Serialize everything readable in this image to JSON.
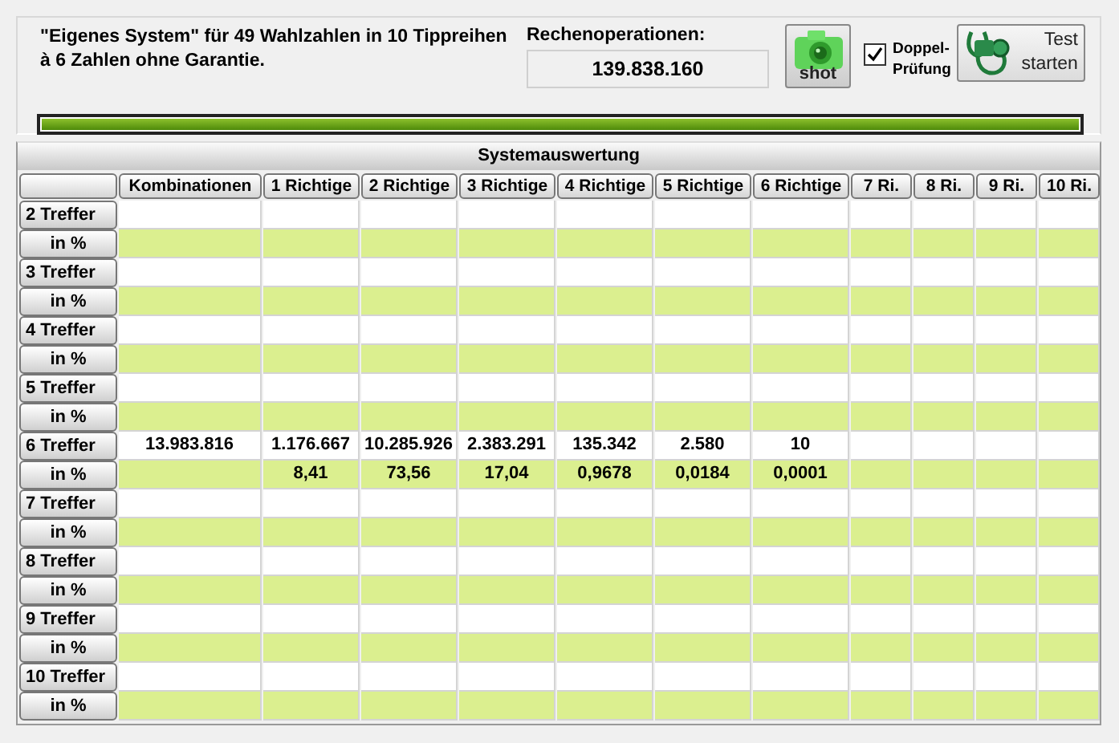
{
  "description_lines": [
    "\"Eigenes System\" für 49 Wahlzahlen in 10 Tippreihen",
    "à 6 Zahlen ohne Garantie."
  ],
  "operations": {
    "label": "Rechenoperationen:",
    "value": "139.838.160"
  },
  "shot_button": {
    "label": "shot"
  },
  "double_check": {
    "label_lines": [
      "Doppel-",
      "Prüfung"
    ],
    "checked": true
  },
  "test_button": {
    "label_lines": [
      "Test",
      "starten"
    ]
  },
  "progress": {
    "level": 1
  },
  "table": {
    "title": "Systemauswertung",
    "columns": [
      "Kombinationen",
      "1 Richtige",
      "2 Richtige",
      "3 Richtige",
      "4 Richtige",
      "5 Richtige",
      "6 Richtige",
      "7 Ri.",
      "8 Ri.",
      "9 Ri.",
      "10 Ri."
    ],
    "rows": [
      {
        "label": "2 Treffer",
        "kind": "count"
      },
      {
        "label": "in %",
        "kind": "percent"
      },
      {
        "label": "3 Treffer",
        "kind": "count"
      },
      {
        "label": "in %",
        "kind": "percent"
      },
      {
        "label": "4 Treffer",
        "kind": "count"
      },
      {
        "label": "in %",
        "kind": "percent"
      },
      {
        "label": "5 Treffer",
        "kind": "count"
      },
      {
        "label": "in %",
        "kind": "percent"
      },
      {
        "label": "6 Treffer",
        "kind": "count",
        "values": [
          "13.983.816",
          "1.176.667",
          "10.285.926",
          "2.383.291",
          "135.342",
          "2.580",
          "10"
        ]
      },
      {
        "label": "in %",
        "kind": "percent",
        "blank_first_cell": true,
        "values": [
          "8,41",
          "73,56",
          "17,04",
          "0,9678",
          "0,0184",
          "0,0001"
        ]
      },
      {
        "label": "7 Treffer",
        "kind": "count"
      },
      {
        "label": "in %",
        "kind": "percent"
      },
      {
        "label": "8 Treffer",
        "kind": "count"
      },
      {
        "label": "in %",
        "kind": "percent"
      },
      {
        "label": "9 Treffer",
        "kind": "count"
      },
      {
        "label": "in %",
        "kind": "percent"
      },
      {
        "label": "10 Treffer",
        "kind": "count"
      },
      {
        "label": "in %",
        "kind": "percent"
      }
    ]
  }
}
